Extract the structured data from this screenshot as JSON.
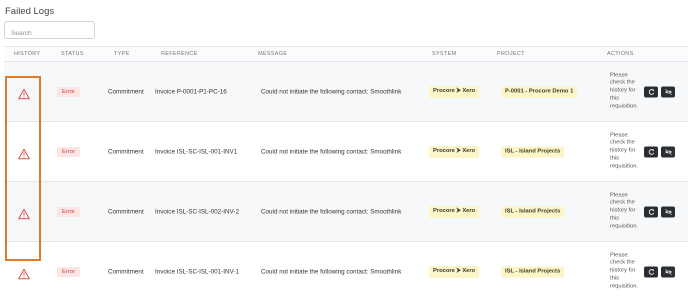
{
  "page": {
    "title": "Failed Logs"
  },
  "search": {
    "placeholder": "Search"
  },
  "table": {
    "headers": {
      "history": "HISTORY",
      "status": "STATUS",
      "type": "TYPE",
      "reference": "REFERENCE",
      "message": "MESSAGE",
      "system": "SYSTEM",
      "project": "PROJECT",
      "actions": "ACTIONS"
    },
    "rows": [
      {
        "status": "Error",
        "type": "Commitment",
        "reference": "Invoice P-0001-P1-PC-16",
        "message": "Could not initiate the following contact: Smoothlink",
        "system": "Procore ⮞ Xero",
        "project": "P-0001 - Procore Demo 1",
        "action_text": "Please check the history for this requisition."
      },
      {
        "status": "Error",
        "type": "Commitment",
        "reference": "Invoice ISL-SC-ISL-001-INV1",
        "message": "Could not initiate the following contact: Smoothlink",
        "system": "Procore ⮞ Xero",
        "project": "ISL - Island Projects",
        "action_text": "Please check the history for this requisition."
      },
      {
        "status": "Error",
        "type": "Commitment",
        "reference": "Invoice ISL-SC-ISL-002-INV-2",
        "message": "Could not initiate the following contact: Smoothlink",
        "system": "Procore ⮞ Xero",
        "project": "ISL - Island Projects",
        "action_text": "Please check the history for this requisition."
      },
      {
        "status": "Error",
        "type": "Commitment",
        "reference": "Invoice ISL-SC-ISL-001-INV-1",
        "message": "Could not initiate the following contact: Smoothlink",
        "system": "Procore ⮞ Xero",
        "project": "ISL - Island Projects",
        "action_text": "Please check the history for this requisition."
      }
    ]
  },
  "icons": {
    "history": "warning-triangle-icon",
    "retry": "refresh-icon",
    "ignore": "eye-slash-icon"
  },
  "colors": {
    "error_text": "#c9453f",
    "error_bg": "#fbe5e5",
    "pill_bg": "#fcf5c8",
    "button_bg": "#2a2d32",
    "highlight": "#e07a2b",
    "warning_icon": "#d9534f"
  }
}
